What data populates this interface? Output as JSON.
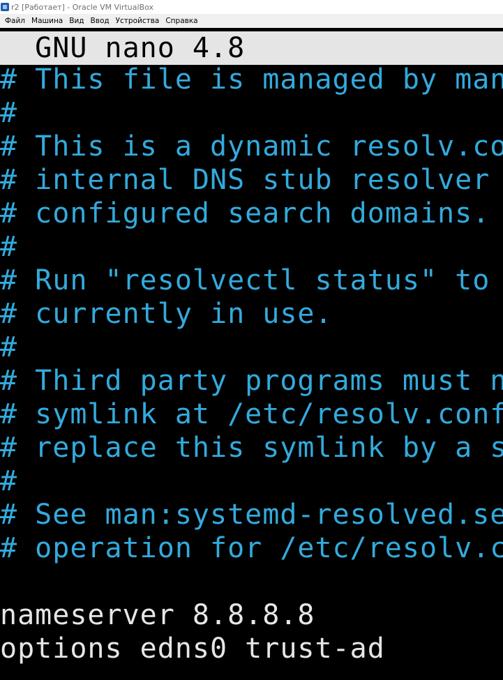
{
  "window": {
    "title": "r2 [Работает] - Oracle VM VirtualBox"
  },
  "menu": [
    "Файл",
    "Машина",
    "Вид",
    "Ввод",
    "Устройства",
    "Справка"
  ],
  "editor": {
    "header": "  GNU nano 4.8",
    "lines": [
      "# This file is managed by man:",
      "#",
      "# This is a dynamic resolv.con",
      "# internal DNS stub resolver o",
      "# configured search domains.",
      "#",
      "# Run \"resolvectl status\" to s",
      "# currently in use.",
      "#",
      "# Third party programs must no",
      "# symlink at /etc/resolv.conf.",
      "# replace this symlink by a st",
      "#",
      "# See man:systemd-resolved.ser",
      "# operation for /etc/resolv.co",
      "",
      "nameserver 8.8.8.8",
      "options edns0 trust-ad"
    ]
  },
  "colors": {
    "comment": "#33aadc",
    "text": "#e6e6e6",
    "header_bg": "#e5e5e5",
    "background": "#000000"
  }
}
